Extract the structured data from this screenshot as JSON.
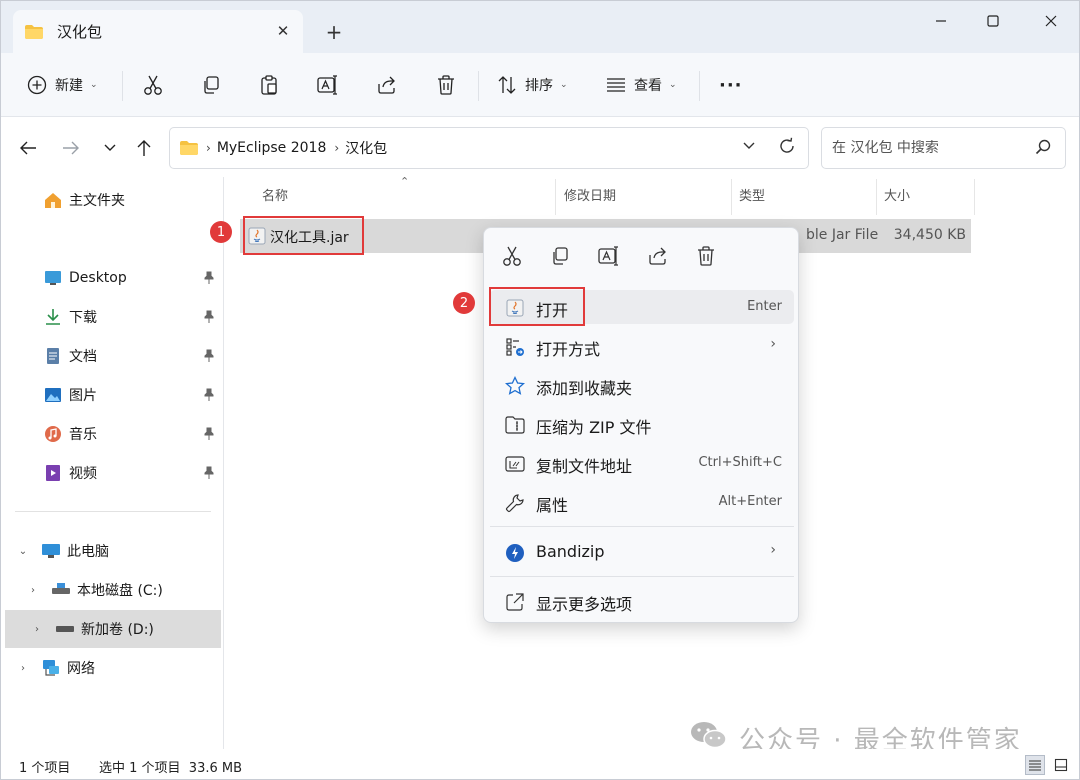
{
  "tabs": [
    {
      "label": "汉化包"
    }
  ],
  "toolbar": {
    "new_label": "新建",
    "sort_label": "排序",
    "view_label": "查看",
    "more_label": "···"
  },
  "address": {
    "crumbs": [
      "MyEclipse 2018",
      "汉化包"
    ],
    "search_placeholder": "在 汉化包 中搜索"
  },
  "sidebar": {
    "home": "主文件夹",
    "quick": [
      {
        "label": "Desktop"
      },
      {
        "label": "下载"
      },
      {
        "label": "文档"
      },
      {
        "label": "图片"
      },
      {
        "label": "音乐"
      },
      {
        "label": "视频"
      }
    ],
    "pc": "此电脑",
    "drives": [
      {
        "label": "本地磁盘 (C:)"
      },
      {
        "label": "新加卷 (D:)"
      }
    ],
    "network": "网络"
  },
  "columns": {
    "name": "名称",
    "modified": "修改日期",
    "type": "类型",
    "size": "大小"
  },
  "file": {
    "name": "汉化工具.jar",
    "type_visible": "ble Jar File",
    "size": "34,450 KB"
  },
  "annotations": {
    "step1": "1",
    "step2": "2"
  },
  "context_menu": {
    "items": [
      {
        "label": "打开",
        "shortcut": "Enter"
      },
      {
        "label": "打开方式",
        "submenu": "›"
      },
      {
        "label": "添加到收藏夹"
      },
      {
        "label": "压缩为 ZIP 文件"
      },
      {
        "label": "复制文件地址",
        "shortcut": "Ctrl+Shift+C"
      },
      {
        "label": "属性",
        "shortcut": "Alt+Enter"
      },
      {
        "label": "Bandizip",
        "submenu": "›"
      },
      {
        "label": "显示更多选项"
      }
    ]
  },
  "status": {
    "count": "1 个项目",
    "selected": "选中 1 个项目  33.6 MB"
  },
  "watermark": "公众号 · 最全软件管家",
  "colors": {
    "accent": "#0067c0",
    "highlight": "#e13a3a",
    "selected_row": "#d9d9d9"
  }
}
